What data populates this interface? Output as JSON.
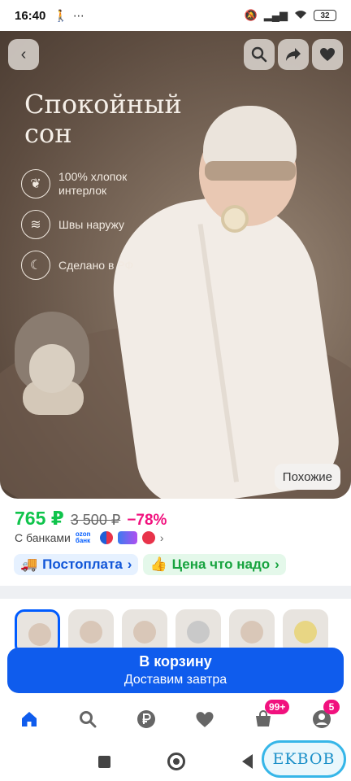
{
  "status_bar": {
    "time": "16:40",
    "battery": "32"
  },
  "hero": {
    "title": "Спокойный сон",
    "features": [
      {
        "icon": "leaf-icon",
        "text": "100% хлопок интерлок"
      },
      {
        "icon": "seam-icon",
        "text": "Швы наружу"
      },
      {
        "icon": "moon-icon",
        "text": "Сделано в РФ"
      }
    ],
    "similar_label": "Похожие"
  },
  "price": {
    "current": "765 ₽",
    "old": "3 500 ₽",
    "discount": "−78%"
  },
  "banks": {
    "label": "С банками",
    "ozon_logo_text": "ozon банк"
  },
  "tags": {
    "postpay": "Постоплата",
    "fair_price": "Цена что надо"
  },
  "cart": {
    "label": "В корзину",
    "delivery": "Доставим завтра"
  },
  "nav": {
    "cart_badge": "99+",
    "profile_badge": "5"
  },
  "watermark": "EKBOB",
  "colors": {
    "accent_blue": "#0f5ced",
    "price_green": "#10c44c",
    "discount_pink": "#f1117e"
  }
}
